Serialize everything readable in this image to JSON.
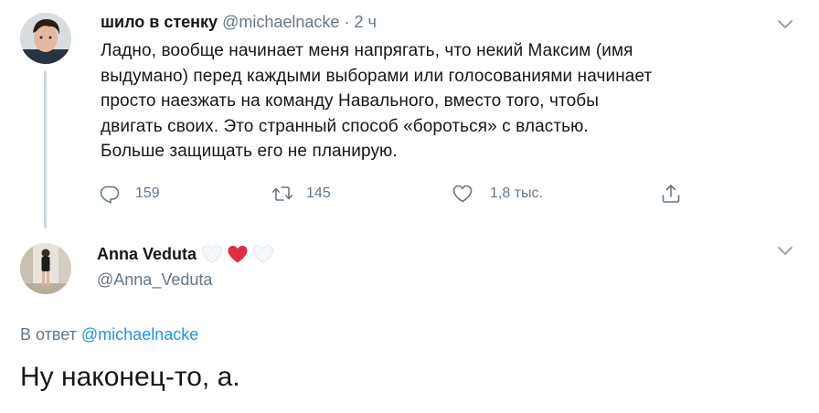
{
  "tweet1": {
    "author_name": "шило в стенку",
    "handle": "@michaelnacke",
    "separator": "·",
    "time": "2 ч",
    "text_lines": [
      "Ладно, вообще начинает меня напрягать, что некий Максим (имя",
      "выдумано) перед каждыми выборами или голосованиями начинает",
      "просто наезжать на команду Навального, вместо того, чтобы",
      "двигать своих. Это странный способ «бороться» с властью.",
      "Больше защищать его не планирую."
    ],
    "replies": "159",
    "retweets": "145",
    "likes": "1,8 тыс."
  },
  "tweet2": {
    "author_name": "Anna Veduta",
    "handle": "@Anna_Veduta",
    "reply_prefix": "В ответ",
    "reply_mention": "@michaelnacke",
    "text": "Ну наконец-то, а."
  },
  "icons": {
    "reply": "reply-icon",
    "retweet": "retweet-icon",
    "like": "heart-icon",
    "share": "share-icon",
    "menu": "chevron-down-icon"
  },
  "colors": {
    "text": "#14171a",
    "secondary": "#657786",
    "link": "#1b95e0",
    "heart_red": "#e0245e",
    "heart_white": "#f5f8fa"
  }
}
